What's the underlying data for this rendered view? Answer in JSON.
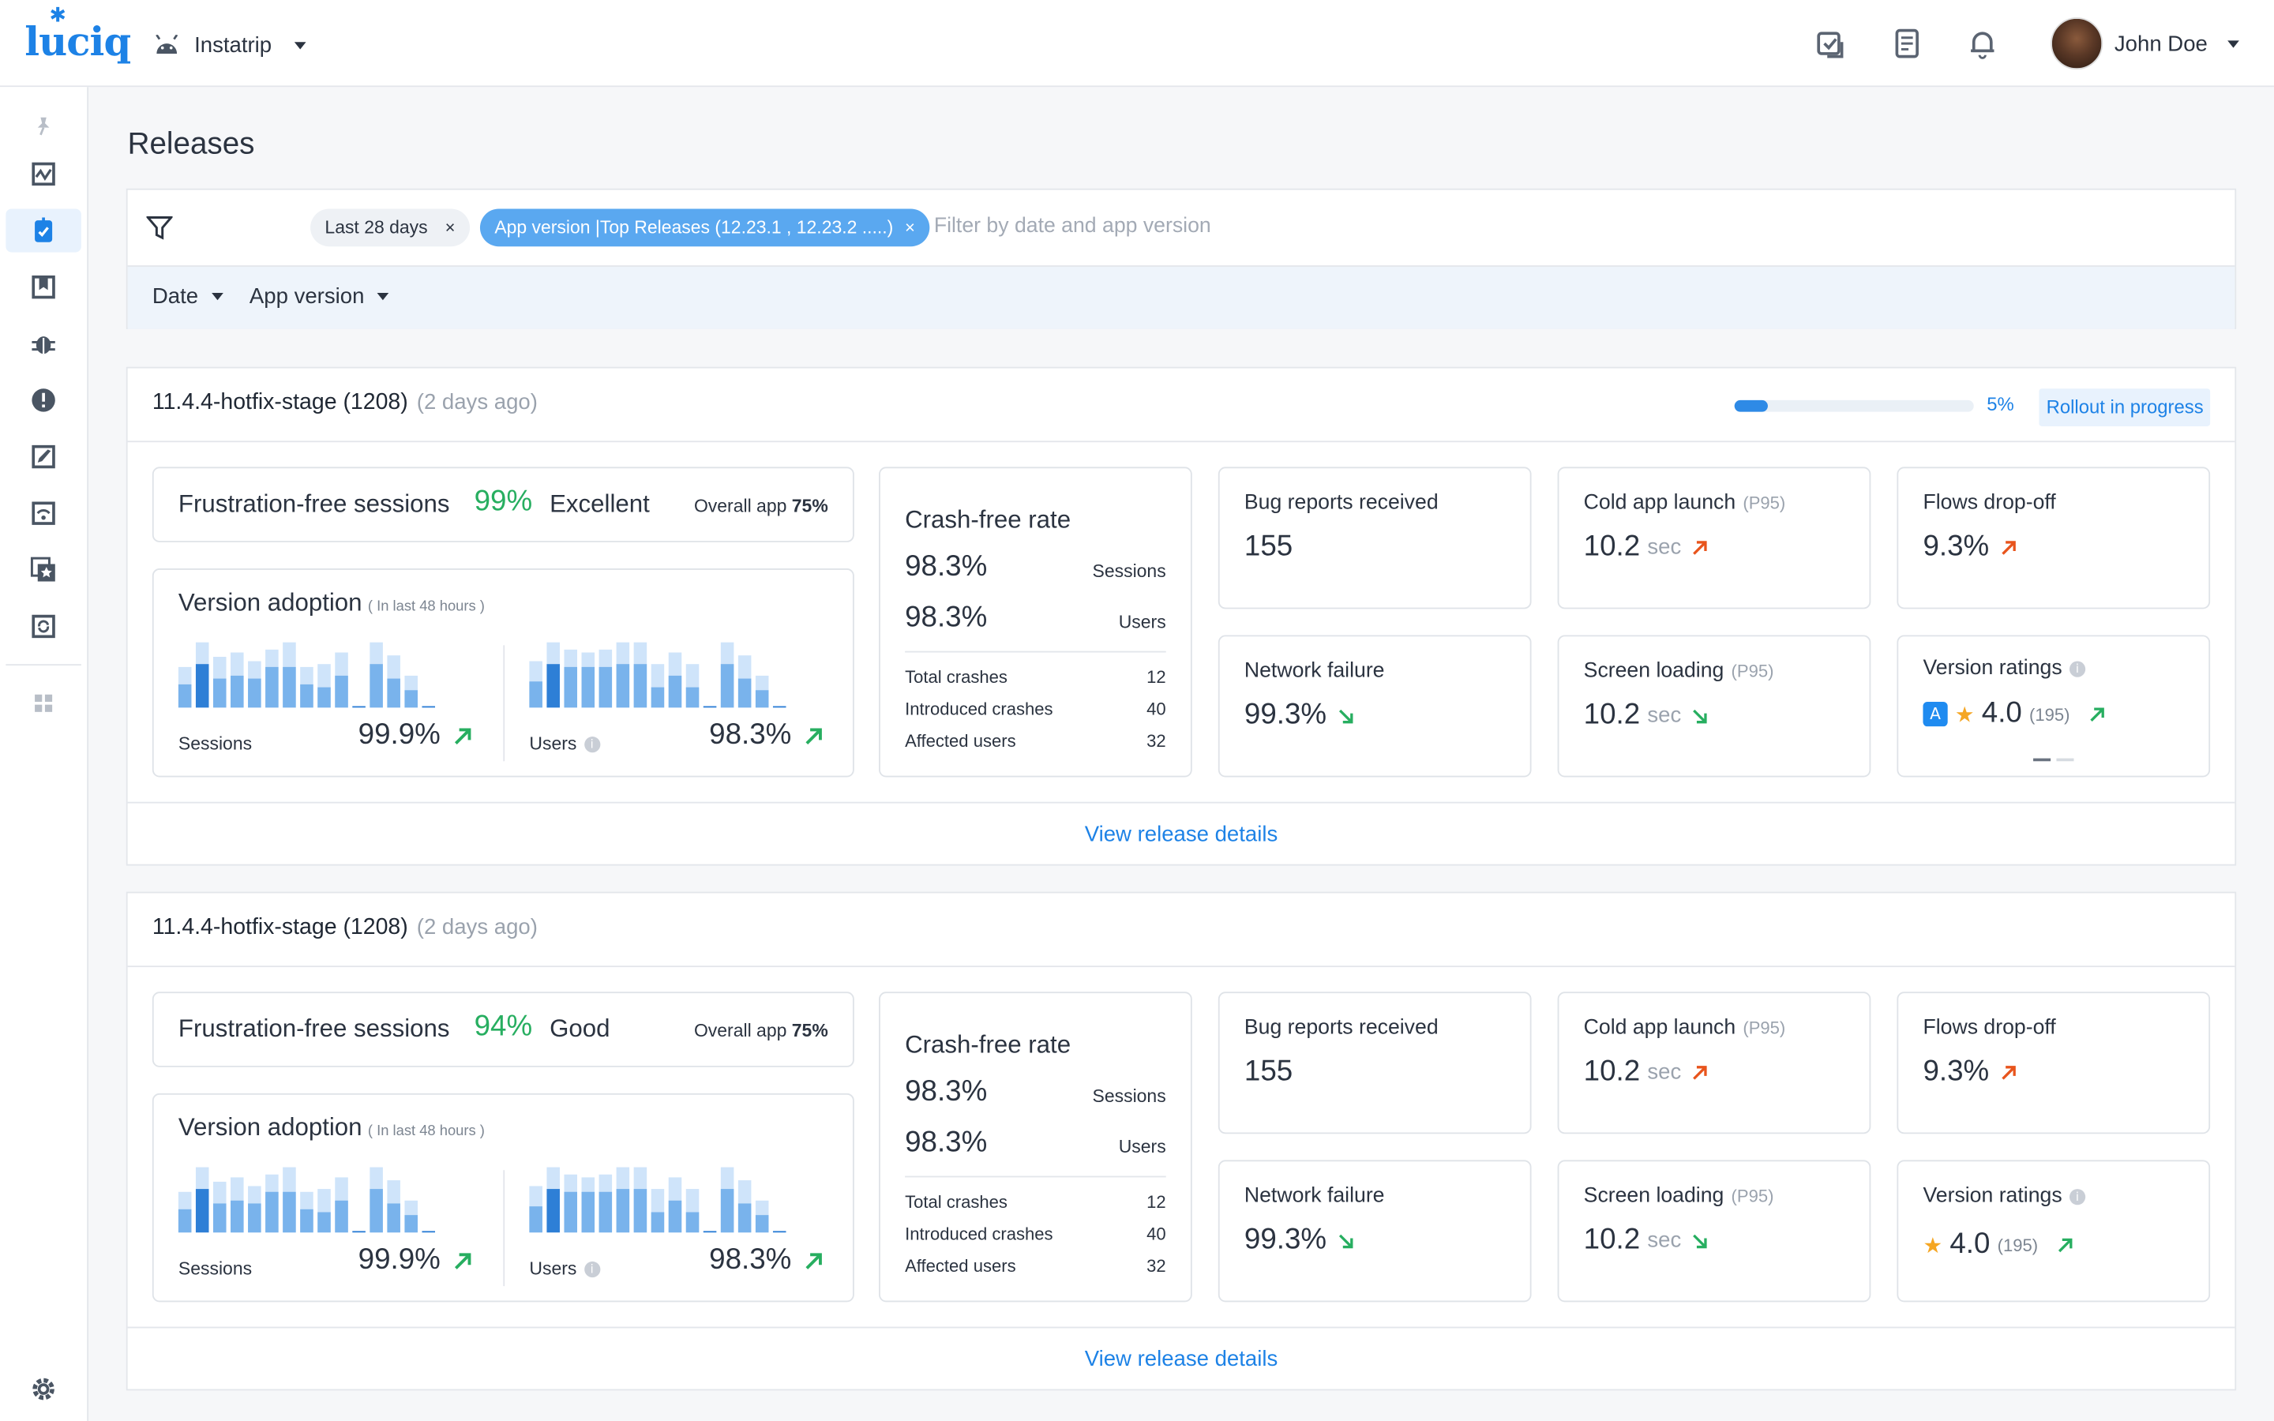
{
  "header": {
    "logo": "luciq",
    "app_name": "Instatrip",
    "user_name": "John Doe"
  },
  "page": {
    "title": "Releases"
  },
  "filters": {
    "chip_date": "Last 28 days",
    "chip_version_prefix": "App version | ",
    "chip_version_value": "Top Releases (12.23.1 , 12.23.2 .....)",
    "chip_close": "×",
    "placeholder": "Filter by date and app version",
    "dropdown_date": "Date",
    "dropdown_version": "App version"
  },
  "releases": [
    {
      "name": "11.4.4-hotfix-stage (1208)",
      "ago": "(2 days ago)",
      "rollout_pct": "5%",
      "rollout_fraction": 0.05,
      "rollout_status": "Rollout in progress",
      "frustration": {
        "label": "Frustration-free sessions",
        "value": "99%",
        "rating": "Excellent",
        "overall_label": "Overall app",
        "overall_value": "75%"
      },
      "adoption": {
        "title": "Version adoption",
        "subtitle": "( In last 48 hours )",
        "sessions_label": "Sessions",
        "sessions_value": "99.9%",
        "users_label": "Users",
        "users_value": "98.3%"
      },
      "crash": {
        "title": "Crash-free rate",
        "sessions_value": "98.3%",
        "sessions_label": "Sessions",
        "users_value": "98.3%",
        "users_label": "Users",
        "rows": [
          {
            "label": "Total crashes",
            "value": "12"
          },
          {
            "label": "Introduced crashes",
            "value": "40"
          },
          {
            "label": "Affected users",
            "value": "32"
          }
        ]
      },
      "bug_reports": {
        "label": "Bug reports received",
        "value": "155"
      },
      "cold_launch": {
        "label": "Cold app launch",
        "tag": "(P95)",
        "value": "10.2",
        "unit": "sec",
        "trend": "up-bad"
      },
      "flows": {
        "label": "Flows drop-off",
        "value": "9.3%",
        "trend": "up-bad"
      },
      "network": {
        "label": "Network failure",
        "value": "99.3%",
        "trend": "down-good"
      },
      "screen_loading": {
        "label": "Screen loading",
        "tag": "(P95)",
        "value": "10.2",
        "unit": "sec",
        "trend": "down-good"
      },
      "ratings": {
        "label": "Version ratings",
        "store_icon": "A",
        "value": "4.0",
        "count": "(195)",
        "trend": "up-good",
        "show_store": true
      }
    },
    {
      "name": "11.4.4-hotfix-stage (1208)",
      "ago": "(2 days ago)",
      "frustration": {
        "label": "Frustration-free sessions",
        "value": "94%",
        "rating": "Good",
        "overall_label": "Overall app",
        "overall_value": "75%"
      },
      "adoption": {
        "title": "Version adoption",
        "subtitle": "( In last 48 hours )",
        "sessions_label": "Sessions",
        "sessions_value": "99.9%",
        "users_label": "Users",
        "users_value": "98.3%"
      },
      "crash": {
        "title": "Crash-free rate",
        "sessions_value": "98.3%",
        "sessions_label": "Sessions",
        "users_value": "98.3%",
        "users_label": "Users",
        "rows": [
          {
            "label": "Total crashes",
            "value": "12"
          },
          {
            "label": "Introduced crashes",
            "value": "40"
          },
          {
            "label": "Affected users",
            "value": "32"
          }
        ]
      },
      "bug_reports": {
        "label": "Bug reports received",
        "value": "155"
      },
      "cold_launch": {
        "label": "Cold app launch",
        "tag": "(P95)",
        "value": "10.2",
        "unit": "sec",
        "trend": "up-bad"
      },
      "flows": {
        "label": "Flows drop-off",
        "value": "9.3%",
        "trend": "up-bad"
      },
      "network": {
        "label": "Network failure",
        "value": "99.3%",
        "trend": "down-good"
      },
      "screen_loading": {
        "label": "Screen loading",
        "tag": "(P95)",
        "value": "10.2",
        "unit": "sec",
        "trend": "down-good"
      },
      "ratings": {
        "label": "Version ratings",
        "value": "4.0",
        "count": "(195)",
        "trend": "up-good",
        "show_store": false
      }
    }
  ],
  "view_details_label": "View release details",
  "colors": {
    "accent": "#1d82e6",
    "good": "#27ae60",
    "bad": "#e8541c",
    "bar_light": "#cfe4fa",
    "bar_mid": "#79b3ec",
    "bar_dark": "#2e7fd6"
  },
  "sidebar_icons": [
    "pin-icon",
    "dashboard-icon",
    "releases-icon",
    "reports-icon",
    "bug-icon",
    "alert-icon",
    "rocket-icon",
    "network-icon",
    "stars-icon",
    "sync-icon",
    "apps-icon",
    "settings-icon"
  ]
}
